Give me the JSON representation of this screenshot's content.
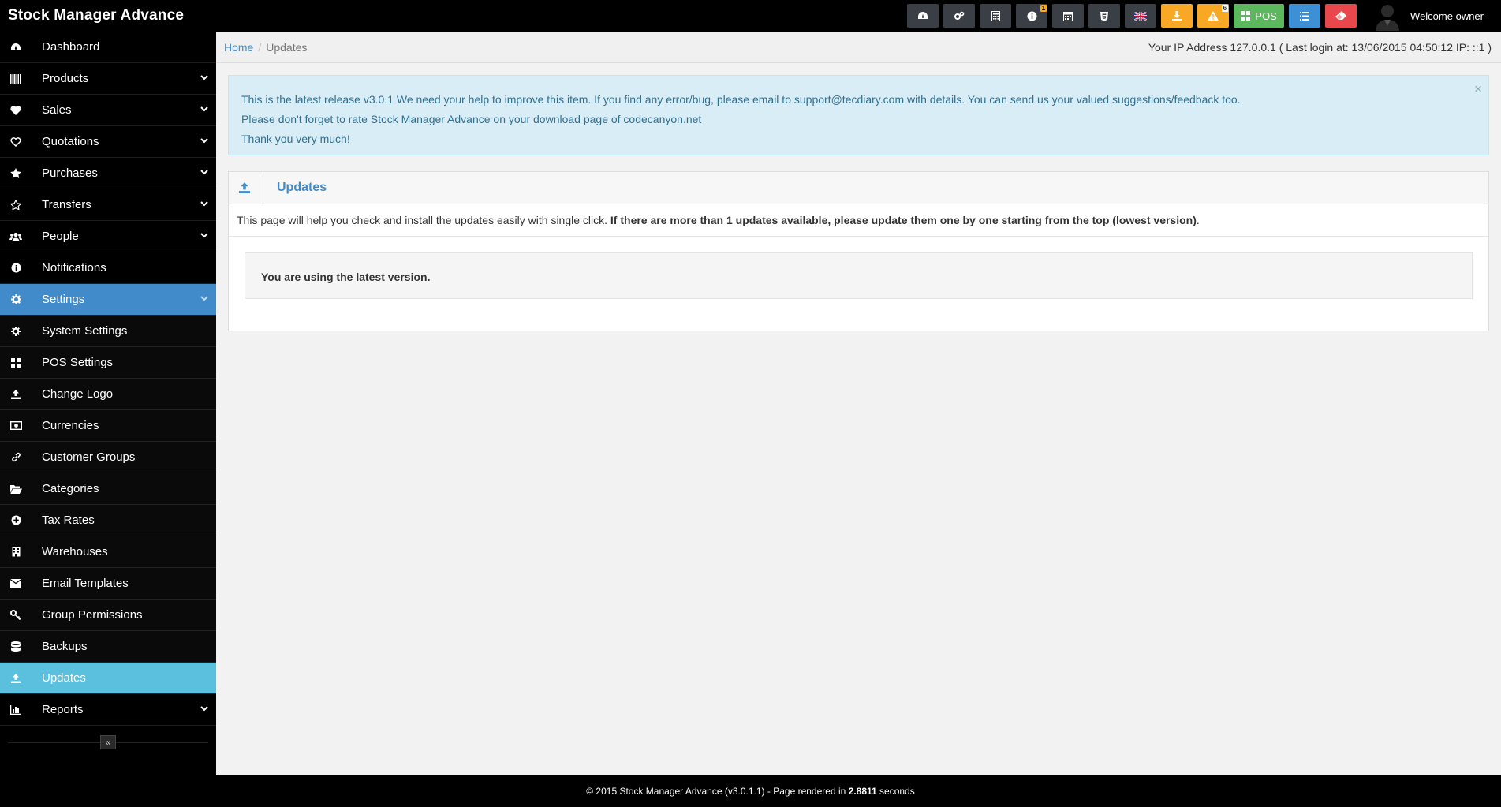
{
  "app": {
    "title": "Stock Manager Advance"
  },
  "header": {
    "pos_label": "POS",
    "info_badge": "1",
    "alert_badge": "6",
    "welcome": "Welcome owner",
    "colors": {
      "orange": "#f9a825",
      "green": "#5cb85c",
      "blue": "#3d8fd6",
      "red": "#e8474b"
    }
  },
  "sidebar": {
    "items": [
      {
        "label": "Dashboard",
        "icon": "dashboard-icon"
      },
      {
        "label": "Products",
        "icon": "barcode-icon"
      },
      {
        "label": "Sales",
        "icon": "heart-icon"
      },
      {
        "label": "Quotations",
        "icon": "heart-outline-icon"
      },
      {
        "label": "Purchases",
        "icon": "star-icon"
      },
      {
        "label": "Transfers",
        "icon": "star-outline-icon"
      },
      {
        "label": "People",
        "icon": "users-icon"
      },
      {
        "label": "Notifications",
        "icon": "info-icon"
      },
      {
        "label": "Settings",
        "icon": "gear-icon"
      }
    ],
    "settings_sub": [
      {
        "label": "System Settings",
        "icon": "gear-icon"
      },
      {
        "label": "POS Settings",
        "icon": "grid-icon"
      },
      {
        "label": "Change Logo",
        "icon": "upload-icon"
      },
      {
        "label": "Currencies",
        "icon": "money-icon"
      },
      {
        "label": "Customer Groups",
        "icon": "link-icon"
      },
      {
        "label": "Categories",
        "icon": "folder-open-icon"
      },
      {
        "label": "Tax Rates",
        "icon": "plus-circle-icon"
      },
      {
        "label": "Warehouses",
        "icon": "building-icon"
      },
      {
        "label": "Email Templates",
        "icon": "envelope-icon"
      },
      {
        "label": "Group Permissions",
        "icon": "key-icon"
      },
      {
        "label": "Backups",
        "icon": "database-icon"
      },
      {
        "label": "Updates",
        "icon": "upload-icon"
      }
    ],
    "reports": {
      "label": "Reports",
      "icon": "bar-chart-icon"
    },
    "collapse": "«"
  },
  "breadcrumb": {
    "home": "Home",
    "separator": "/",
    "current": "Updates"
  },
  "ipinfo": "Your IP Address 127.0.0.1 ( Last login at: 13/06/2015 04:50:12 IP: ::1 )",
  "alert": {
    "line1": "This is the latest release v3.0.1 We need your help to improve this item. If you find any error/bug, please email to support@tecdiary.com with details. You can send us your valued suggestions/feedback too.",
    "line2": "Please don't forget to rate Stock Manager Advance on your download page of codecanyon.net",
    "line3": "Thank you very much!",
    "close": "×"
  },
  "box": {
    "title": "Updates",
    "intro": "This page will help you check and install the updates easily with single click.",
    "intro_bold": "If there are more than 1 updates available, please update them one by one starting from the top (lowest version)",
    "intro_end": ".",
    "status": "You are using the latest version."
  },
  "footer": {
    "prefix": "© 2015 Stock Manager Advance (v3.0.1.1) - Page rendered in",
    "time": "2.8811",
    "suffix": "seconds"
  }
}
